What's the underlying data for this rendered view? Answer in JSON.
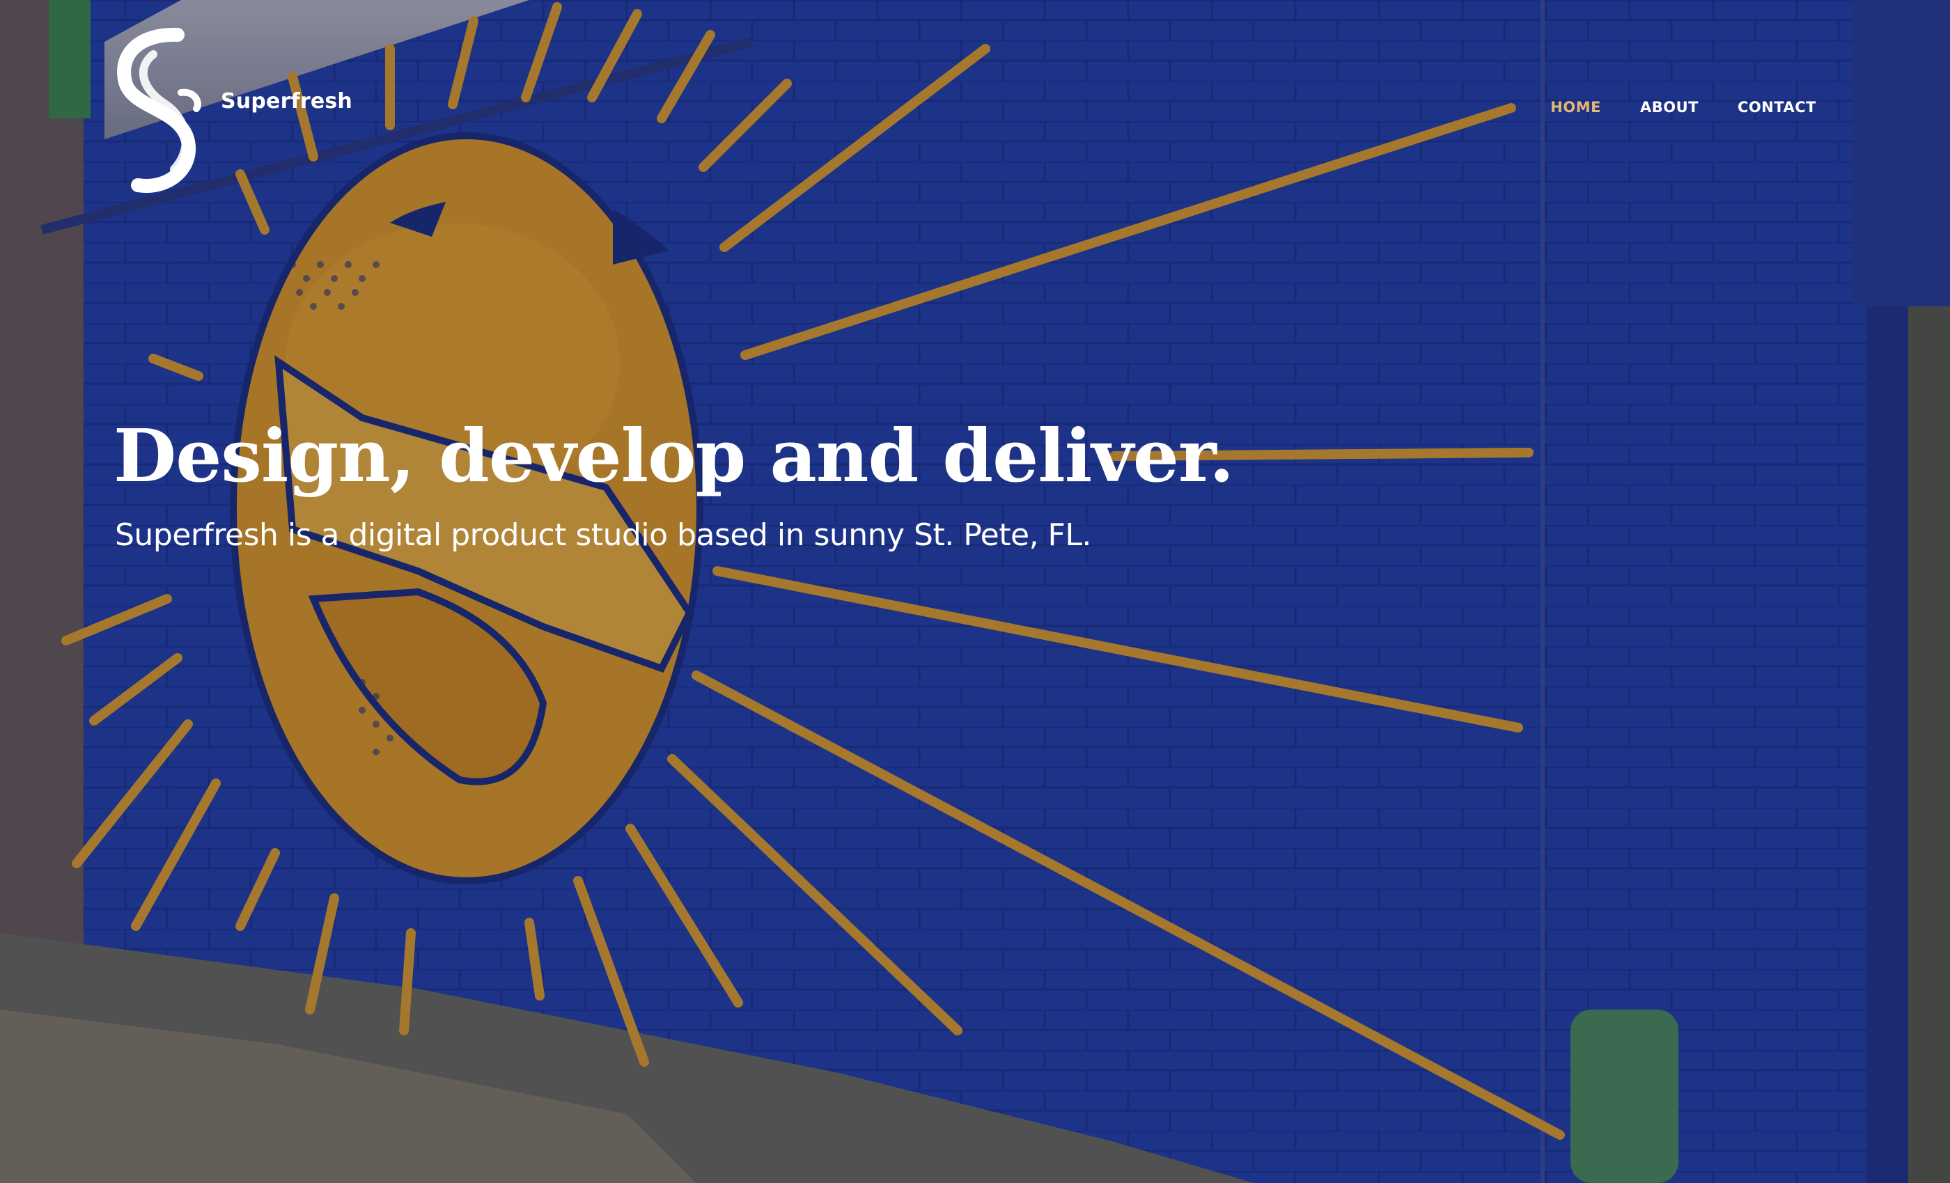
{
  "brand": {
    "name": "Superfresh",
    "logo_icon": "superfresh-sf-logo-icon"
  },
  "nav": {
    "items": [
      {
        "label": "HOME",
        "active": true
      },
      {
        "label": "ABOUT",
        "active": false
      },
      {
        "label": "CONTACT",
        "active": false
      }
    ]
  },
  "hero": {
    "headline_lead": "Design, develop and ",
    "headline_highlight": "deliver.",
    "subheadline": "Superfresh is a digital product studio based in sunny St. Pete, FL.",
    "background": "blue brick wall mural with orange sun face and rays"
  },
  "colors": {
    "accent": "#e2b872",
    "highlight_bar": "#d7ae6f",
    "wall_blue": "#2238a0",
    "sun_orange": "#e09a24"
  }
}
